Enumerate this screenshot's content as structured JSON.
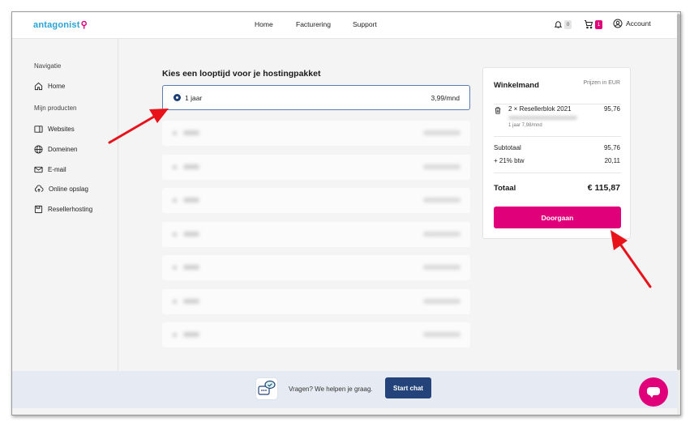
{
  "header": {
    "logo_text": "antagonist",
    "nav": [
      {
        "label": "Home"
      },
      {
        "label": "Facturering"
      },
      {
        "label": "Support"
      }
    ],
    "notifications_count": "0",
    "cart_count": "1",
    "account_label": "Account"
  },
  "sidebar": {
    "heading_nav": "Navigatie",
    "home_label": "Home",
    "heading_products": "Mijn producten",
    "items": [
      {
        "label": "Websites",
        "icon": "browser-window-icon"
      },
      {
        "label": "Domeinen",
        "icon": "globe-icon"
      },
      {
        "label": "E-mail",
        "icon": "envelope-icon"
      },
      {
        "label": "Online opslag",
        "icon": "cloud-upload-icon"
      },
      {
        "label": "Resellerhosting",
        "icon": "server-box-icon"
      }
    ]
  },
  "main": {
    "heading": "Kies een looptijd voor je hostingpakket",
    "selected_option": {
      "label": "1 jaar",
      "price": "3,99/mnd"
    },
    "blurred_option_count_note": "other options are blurred/unreadable"
  },
  "cart": {
    "title": "Winkelmand",
    "price_note": "Prijzen in EUR",
    "item": {
      "name": "2 × Resellerblok 2021",
      "price": "95,76",
      "detail": "1 jaar 7,98/mnd"
    },
    "subtotal_label": "Subtotaal",
    "subtotal_value": "95,76",
    "vat_label": "+ 21% btw",
    "vat_value": "20,11",
    "total_label": "Totaal",
    "total_value": "€ 115,87",
    "continue_button": "Doorgaan"
  },
  "footer": {
    "help_text": "Vragen? We helpen je graag.",
    "chat_button": "Start chat"
  },
  "colors": {
    "brand_pink": "#e0007a",
    "brand_blue": "#24437a",
    "annotation_red": "#e8121b"
  }
}
